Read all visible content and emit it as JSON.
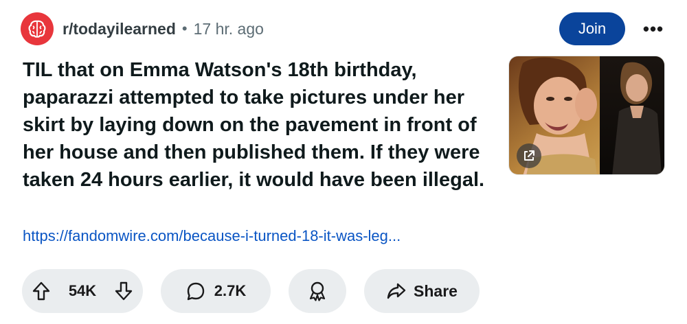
{
  "post": {
    "subreddit": "r/todayilearned",
    "separator": "•",
    "time": "17 hr. ago",
    "join_label": "Join",
    "more_label": "•••",
    "title": "TIL that on Emma Watson's 18th birthday, paparazzi attempted to take pictures under her skirt by laying down on the pavement in front of her house and then published them. If they were taken 24 hours earlier, it would have been illegal.",
    "link": "https://fandomwire.com/because-i-turned-18-it-was-leg...",
    "votes": "54K",
    "comments": "2.7K",
    "share_label": "Share"
  },
  "icons": {
    "subreddit_avatar": "brain-icon",
    "upvote": "arrow-up-icon",
    "downvote": "arrow-down-icon",
    "comment": "speech-bubble-icon",
    "award": "award-ribbon-icon",
    "share": "share-arrow-icon",
    "external": "external-link-icon"
  },
  "colors": {
    "avatar_bg": "#e8363c",
    "join_bg": "#0a449b",
    "link": "#0a55c4",
    "pill_bg": "#eaedef",
    "meta": "#5c6c74"
  }
}
